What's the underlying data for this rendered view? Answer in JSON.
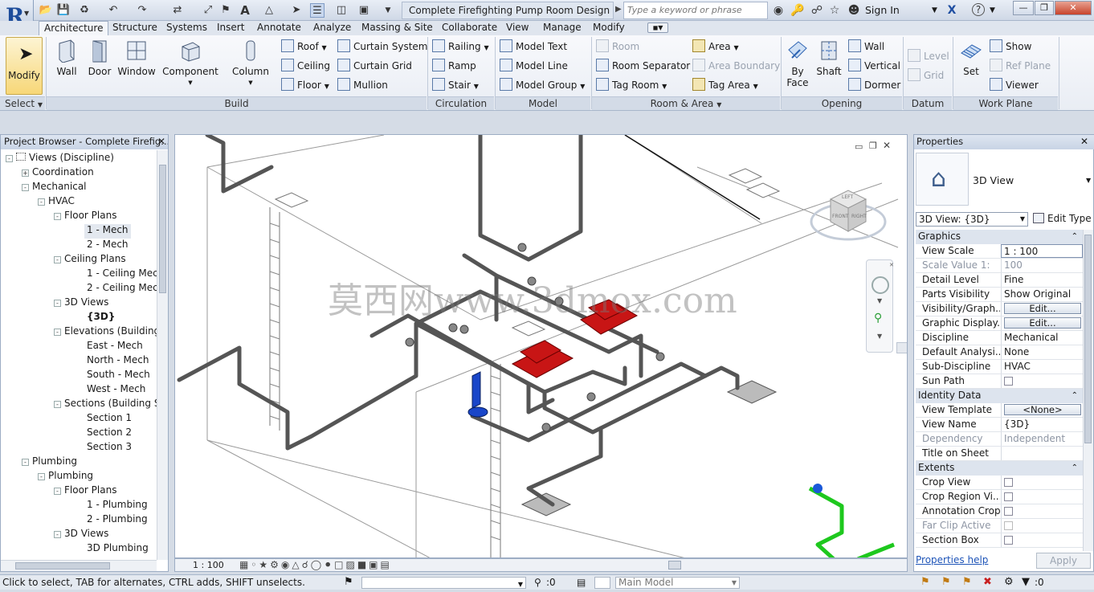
{
  "title_bar": {
    "document_title": "Complete Firefighting Pump Room Design - 3...",
    "search_placeholder": "Type a keyword or phrase",
    "sign_in": "Sign In"
  },
  "tabs": [
    "Architecture",
    "Structure",
    "Systems",
    "Insert",
    "Annotate",
    "Analyze",
    "Massing & Site",
    "Collaborate",
    "View",
    "Manage",
    "Modify"
  ],
  "ribbon": {
    "select": {
      "modify": "Modify",
      "label": "Select"
    },
    "build": {
      "wall": "Wall",
      "door": "Door",
      "window": "Window",
      "component": "Component",
      "column": "Column",
      "roof": "Roof",
      "ceiling": "Ceiling",
      "floor": "Floor",
      "curtain_system": "Curtain System",
      "curtain_grid": "Curtain Grid",
      "mullion": "Mullion",
      "label": "Build"
    },
    "circulation": {
      "railing": "Railing",
      "ramp": "Ramp",
      "stair": "Stair",
      "label": "Circulation"
    },
    "model": {
      "model_text": "Model Text",
      "model_line": "Model Line",
      "model_group": "Model Group",
      "label": "Model"
    },
    "room_area": {
      "room": "Room",
      "room_separator": "Room Separator",
      "tag_room": "Tag Room",
      "area": "Area",
      "area_boundary": "Area Boundary",
      "tag_area": "Tag Area",
      "label": "Room & Area"
    },
    "opening": {
      "by_face_1": "By",
      "by_face_2": "Face",
      "shaft": "Shaft",
      "wall": "Wall",
      "vertical": "Vertical",
      "dormer": "Dormer",
      "label": "Opening"
    },
    "datum": {
      "level": "Level",
      "grid": "Grid",
      "label": "Datum"
    },
    "work_plane": {
      "set": "Set",
      "show": "Show",
      "ref_plane": "Ref Plane",
      "viewer": "Viewer",
      "label": "Work Plane"
    }
  },
  "project_browser": {
    "title": "Project Browser - Complete Firefig...",
    "items": [
      {
        "label": "Views (Discipline)",
        "toggle": "-"
      },
      {
        "label": "Coordination",
        "toggle": "+"
      },
      {
        "label": "Mechanical",
        "toggle": "-"
      },
      {
        "label": "HVAC",
        "toggle": "-"
      },
      {
        "label": "Floor Plans",
        "toggle": "-"
      },
      {
        "label": "1 - Mech",
        "toggle": ""
      },
      {
        "label": "2 - Mech",
        "toggle": ""
      },
      {
        "label": "Ceiling Plans",
        "toggle": "-"
      },
      {
        "label": "1 - Ceiling Mecl",
        "toggle": ""
      },
      {
        "label": "2 - Ceiling Mecl",
        "toggle": ""
      },
      {
        "label": "3D Views",
        "toggle": "-"
      },
      {
        "label": "{3D}",
        "toggle": ""
      },
      {
        "label": "Elevations (Building",
        "toggle": "-"
      },
      {
        "label": "East - Mech",
        "toggle": ""
      },
      {
        "label": "North - Mech",
        "toggle": ""
      },
      {
        "label": "South - Mech",
        "toggle": ""
      },
      {
        "label": "West - Mech",
        "toggle": ""
      },
      {
        "label": "Sections (Building S",
        "toggle": "-"
      },
      {
        "label": "Section 1",
        "toggle": ""
      },
      {
        "label": "Section 2",
        "toggle": ""
      },
      {
        "label": "Section 3",
        "toggle": ""
      },
      {
        "label": "Plumbing",
        "toggle": "-"
      },
      {
        "label": "Plumbing",
        "toggle": "-"
      },
      {
        "label": "Floor Plans",
        "toggle": "-"
      },
      {
        "label": "1 - Plumbing",
        "toggle": ""
      },
      {
        "label": "2 - Plumbing",
        "toggle": ""
      },
      {
        "label": "3D Views",
        "toggle": "-"
      },
      {
        "label": "3D Plumbing",
        "toggle": ""
      }
    ]
  },
  "viewport": {
    "watermark": "莫西网www.3dmox.com",
    "viewcube_top": "LEFT",
    "viewcube_left": "FRONT",
    "viewcube_right": "RIGHT",
    "scale": "1 : 100"
  },
  "properties": {
    "title": "Properties",
    "type_name": "3D View",
    "selector": "3D View: {3D}",
    "edit_type": "Edit Type",
    "groups": [
      {
        "name": "Graphics",
        "rows": [
          {
            "k": "View Scale",
            "v": "1 : 100",
            "kind": "input"
          },
          {
            "k": "Scale Value    1:",
            "v": "100",
            "kind": "dim"
          },
          {
            "k": "Detail Level",
            "v": "Fine",
            "kind": "text"
          },
          {
            "k": "Parts Visibility",
            "v": "Show Original",
            "kind": "text"
          },
          {
            "k": "Visibility/Graph...",
            "v": "Edit...",
            "kind": "button"
          },
          {
            "k": "Graphic Display...",
            "v": "Edit...",
            "kind": "button"
          },
          {
            "k": "Discipline",
            "v": "Mechanical",
            "kind": "text"
          },
          {
            "k": "Default Analysi...",
            "v": "None",
            "kind": "text"
          },
          {
            "k": "Sub-Discipline",
            "v": "HVAC",
            "kind": "text"
          },
          {
            "k": "Sun Path",
            "v": "",
            "kind": "check"
          }
        ]
      },
      {
        "name": "Identity Data",
        "rows": [
          {
            "k": "View Template",
            "v": "<None>",
            "kind": "button"
          },
          {
            "k": "View Name",
            "v": "{3D}",
            "kind": "text"
          },
          {
            "k": "Dependency",
            "v": "Independent",
            "kind": "dim"
          },
          {
            "k": "Title on Sheet",
            "v": "",
            "kind": "text"
          }
        ]
      },
      {
        "name": "Extents",
        "rows": [
          {
            "k": "Crop View",
            "v": "",
            "kind": "check"
          },
          {
            "k": "Crop Region Vi...",
            "v": "",
            "kind": "check"
          },
          {
            "k": "Annotation Crop",
            "v": "",
            "kind": "check"
          },
          {
            "k": "Far Clip Active",
            "v": "",
            "kind": "check"
          },
          {
            "k": "Section Box",
            "v": "",
            "kind": "check"
          }
        ]
      }
    ],
    "help": "Properties help",
    "apply": "Apply"
  },
  "status_bar": {
    "message": "Click to select, TAB for alternates, CTRL adds, SHIFT unselects.",
    "filter_count": ":0",
    "workset": "Main Model",
    "select_count": ":0"
  }
}
